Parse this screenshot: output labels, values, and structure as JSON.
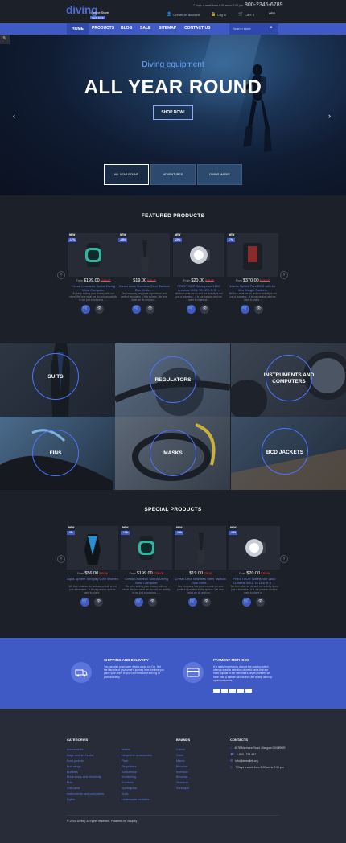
{
  "header": {
    "logo": "diving",
    "logo_sub": "Online Store",
    "logo_tag": "NEW DIVE",
    "hours": "7 Days a week from 9:00 am to 7:00 pm",
    "phone": "800-2345-6789",
    "create_account": "Create an account",
    "login": "Log in",
    "cart": "Cart: 0",
    "currency": "USD"
  },
  "nav": {
    "items": [
      "HOME",
      "PRODUCTS",
      "BLOG",
      "SALE",
      "SITEMAP",
      "CONTACT US"
    ],
    "search_placeholder": "Search store"
  },
  "hero": {
    "subtitle": "Diving equipment",
    "title": "ALL YEAR ROUND",
    "button": "SHOP NOW!",
    "thumbs": [
      "ALL YEAR ROUND",
      "ADVENTURES",
      "DIVING MASKS"
    ]
  },
  "featured": {
    "title": "FEATURED PRODUCTS",
    "products": [
      {
        "badge": "NEW",
        "discount": "-17%",
        "from": "From",
        "price": "$199.00",
        "old": "$239.00",
        "name": "Cressi Leonardo Scuba Diving Wrist Computer",
        "desc": "So keep adding your money with our store! We love what we do and our activity is not just a business - ..."
      },
      {
        "badge": "NEW",
        "discount": "-25%",
        "from": "",
        "price": "$19.00",
        "old": "$25.00",
        "name": "Cressi Lima Stainless Steel Tactical Dive Knife ...",
        "desc": "Our company has great experience and perfect reputation in this sphere. We love what we do and our ..."
      },
      {
        "badge": "NEW",
        "discount": "-20%",
        "from": "From",
        "price": "$20.00",
        "old": "$25.00",
        "name": "FREETOOR Waterproof 1800 Lumens XM-L T6 LED R.S ...",
        "desc": "We love what we do and our activity is not just a business - it is our passion and we want to share wi..."
      },
      {
        "badge": "NEW",
        "discount": "-7%",
        "from": "From",
        "price": "$370.00",
        "old": "$400.00",
        "name": "Mares Hybrid Pure BCD with Mr Mrs Weight Pockets",
        "desc": "We love what we do and our activity is not just a business - it is our passion and we want to share..."
      }
    ]
  },
  "categories": [
    "SUITS",
    "REGULATORS",
    "INSTRUMENTS AND COMPUTERS",
    "FINS",
    "MASKS",
    "BCD JACKETS"
  ],
  "special": {
    "title": "SPECIAL PRODUCTS",
    "products": [
      {
        "badge": "NEW",
        "discount": "-3%",
        "from": "From",
        "price": "$56.00",
        "old": "$58.00",
        "name": "Aqua Sphere Stingray Core Women",
        "desc": "We love what we do and our activity is not just a business - it is our passion and we want to share..."
      },
      {
        "badge": "NEW",
        "discount": "-17%",
        "from": "From",
        "price": "$199.00",
        "old": "$239.00",
        "name": "Cressi Leonardo Scuba Diving Wrist Computer",
        "desc": "So keep adding your money with our store! We love what we do and our activity is not just a business - ..."
      },
      {
        "badge": "NEW",
        "discount": "-25%",
        "from": "",
        "price": "$19.00",
        "old": "$25.00",
        "name": "Cressi Lima Stainless Steel Tactical Dive Knife...",
        "desc": "Our company has great experience and perfect reputation in this sphere. We love what we do and our ..."
      },
      {
        "badge": "NEW",
        "discount": "-20%",
        "from": "From",
        "price": "$20.00",
        "old": "$25.00",
        "name": "FREETOOR Waterproof 1800 Lumens XM-L T6 LED R.S ...",
        "desc": "We love what we do and our activity is not just a business - it is our passion and we want to share wi..."
      }
    ]
  },
  "features": {
    "shipping_title": "SHIPPING AND DELIVERY",
    "shipping_text": "You can also read some details about our Dip. Not the lifecycle of your order's journey from the time you place your order to your new treasured arriving at your doorstep.",
    "payment_title": "PAYMENT METHODS",
    "payment_text": "It is really important to choose the solution which offers a specific selection of credit cards that are most popular in the merchant's target markets. We have Visa & MasterCard as they are widely used by cyber customers."
  },
  "footer": {
    "categories_title": "CATEGORIES",
    "brands_title": "BRANDS",
    "contacts_title": "CONTACTS",
    "col1": [
      "Accessories",
      "Bags and dry bucks",
      "Boot jackets",
      "Bod wings",
      "Bubbles",
      "Electronics and electricity",
      "Fins",
      "Gift cards",
      "Instruments and computers",
      "Lights"
    ],
    "col2": [
      "Masks",
      "Neoprene accessories",
      "Pack",
      "Regulators",
      "Scubamoor",
      "Snorkeling",
      "Snorkels",
      "Speargunsi",
      "Suits",
      "Underwater vehicles"
    ],
    "brands": [
      "Cressi",
      "Omer",
      "Mares",
      "Beuchat",
      "Imersion",
      "Beuchat",
      "Seacsub",
      "Scubapro"
    ],
    "contacts": [
      "4578 Marmora Road, Glasgow D04 89GR",
      "1-800-1234-567",
      "info@demolink.org",
      "7 Days a week from 9:00 am to 7:00 pm"
    ],
    "copyright": "© 2016 Diving. All rights reserved. Powered by Shopify"
  },
  "colors": {
    "accent": "#3f59c5",
    "link": "#5d7be6",
    "dark": "#1c2029"
  }
}
